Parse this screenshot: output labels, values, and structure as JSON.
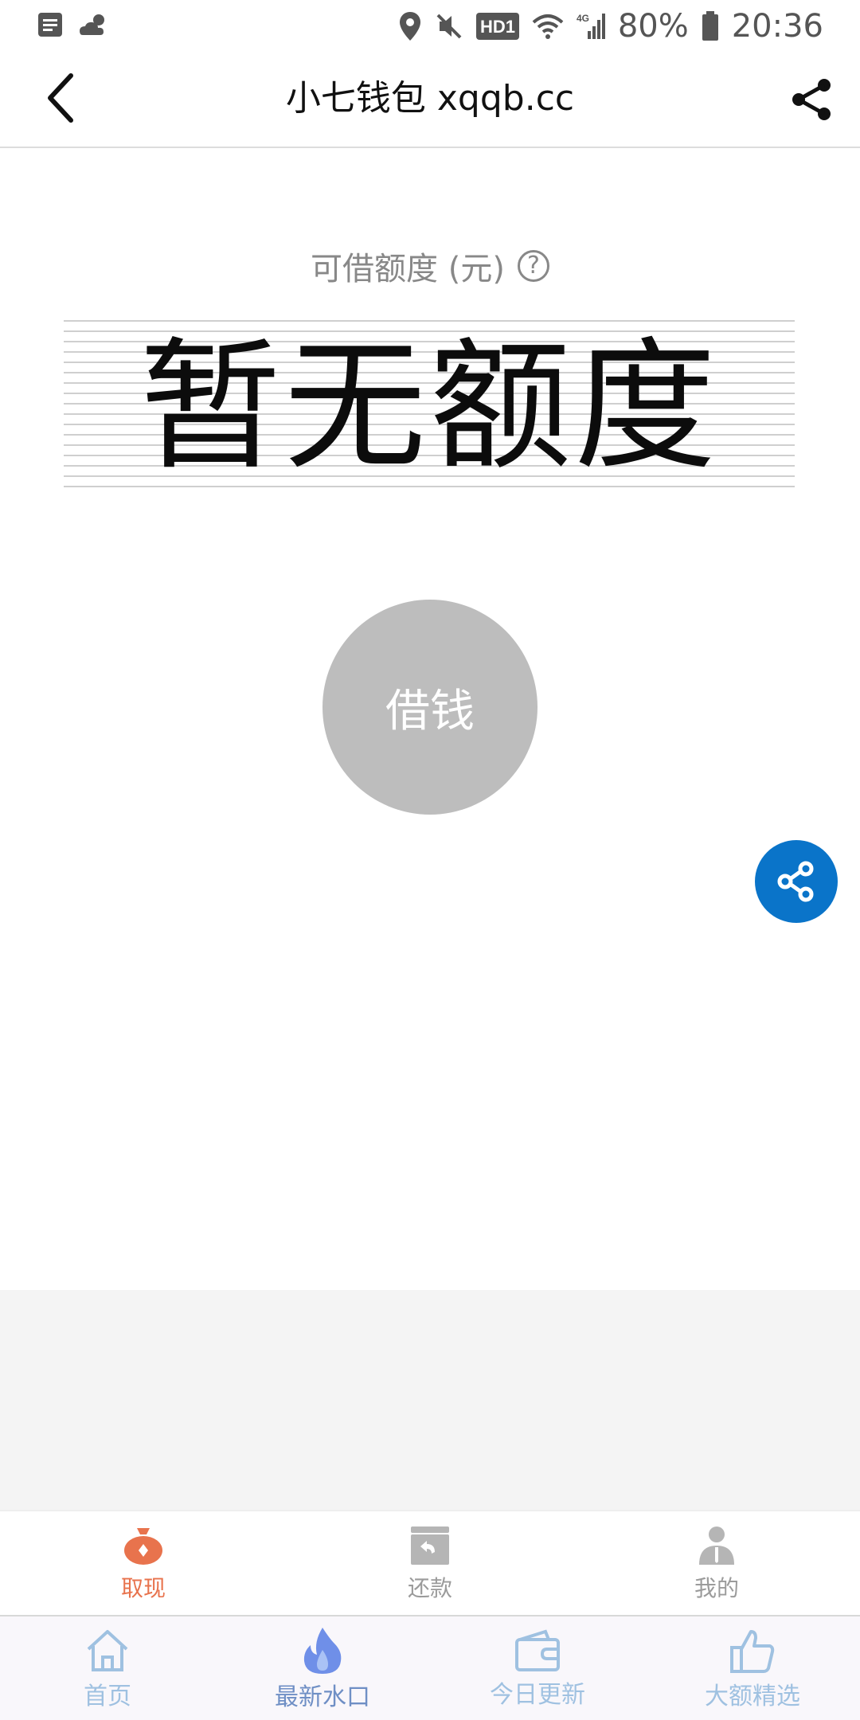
{
  "status_bar": {
    "battery": "80%",
    "time": "20:36",
    "hd_badge": "HD1",
    "network": "4G",
    "icons": [
      "notification-icon",
      "weather-icon",
      "location-icon",
      "mute-icon",
      "wifi-icon",
      "signal-icon",
      "battery-icon"
    ]
  },
  "app_bar": {
    "title": "小七钱包 xqqb.cc",
    "back_icon": "chevron-left-icon",
    "share_icon": "share-icon"
  },
  "credit": {
    "label": "可借额度 (元)",
    "help_icon": "?",
    "value": "暂无额度"
  },
  "borrow_button": {
    "label": "借钱"
  },
  "inner_tabs": [
    {
      "label": "取现",
      "icon": "money-bag-icon",
      "active": true
    },
    {
      "label": "还款",
      "icon": "repay-icon",
      "active": false
    },
    {
      "label": "我的",
      "icon": "user-icon",
      "active": false
    }
  ],
  "bottom_nav": [
    {
      "label": "首页",
      "icon": "home-icon",
      "active": false
    },
    {
      "label": "最新水口",
      "icon": "fire-icon",
      "active": true
    },
    {
      "label": "今日更新",
      "icon": "wallet-icon",
      "active": false
    },
    {
      "label": "大额精选",
      "icon": "thumbs-up-icon",
      "active": false
    }
  ],
  "colors": {
    "accent_orange": "#e8734d",
    "float_blue": "#0a74c9",
    "nav_blue": "#9fc1e1",
    "button_grey": "#bdbdbd"
  }
}
